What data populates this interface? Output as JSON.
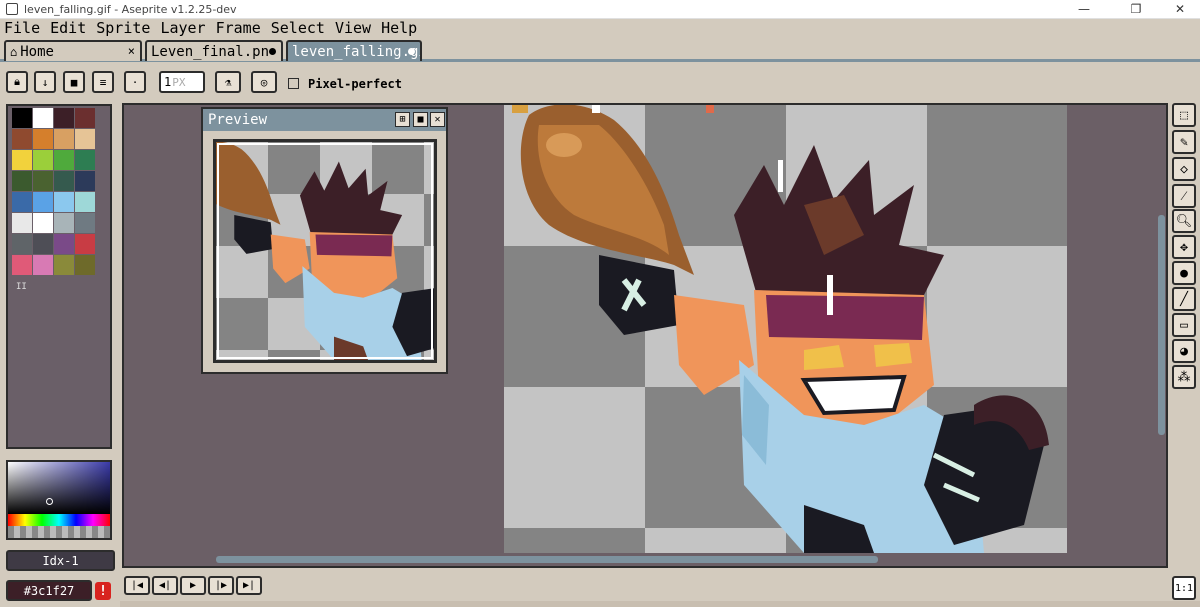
{
  "window": {
    "title": "leven_falling.gif - Aseprite v1.2.25-dev",
    "minimize": "—",
    "maximize": "❐",
    "close": "✕"
  },
  "menu": [
    "File",
    "Edit",
    "Sprite",
    "Layer",
    "Frame",
    "Select",
    "View",
    "Help"
  ],
  "tabs": [
    {
      "label": "Home",
      "icon": "home-icon",
      "trailing": "×",
      "active": false
    },
    {
      "label": "Leven_final.pn",
      "trailing": "dot",
      "active": false
    },
    {
      "label": "leven_falling.gi",
      "trailing": "dot",
      "active": true
    }
  ],
  "context_bar": {
    "brush_size_value": "1",
    "brush_size_unit": "PX",
    "pixel_perfect_label": "Pixel-perfect",
    "pixel_perfect_checked": false
  },
  "palette": {
    "colors": [
      "#000000",
      "#ffffff",
      "#3c1f27",
      "#6b2f2f",
      "#8f4a2f",
      "#d57f2c",
      "#d8a062",
      "#e6c496",
      "#f2d23c",
      "#9bcf3a",
      "#4faa3c",
      "#2d7d52",
      "#3b5a2e",
      "#4a6230",
      "#355a4e",
      "#2c3a5a",
      "#3a6aa8",
      "#5aa2e6",
      "#8bc8ee",
      "#9ed8d8",
      "#e8e8e8",
      "#ffffff",
      "#a8b4b8",
      "#6f7a82",
      "#5f6468",
      "#4e4e56",
      "#7a4a88",
      "#c83c44",
      "#e05a78",
      "#d87ab4",
      "#8a8a3a",
      "#6e6a2a"
    ],
    "badge": "II"
  },
  "color": {
    "index_label": "Idx-1",
    "hex": "#3c1f27",
    "warning_glyph": "!"
  },
  "preview": {
    "title": "Preview"
  },
  "tools": [
    "rectangular-marquee-icon",
    "pencil-icon",
    "eraser-icon",
    "eyedropper-icon",
    "zoom-icon",
    "move-icon",
    "paint-bucket-icon",
    "line-icon",
    "rectangle-icon",
    "blur-icon",
    "spray-icon"
  ],
  "animation": {
    "buttons": [
      "first-frame",
      "previous-frame",
      "play",
      "next-frame",
      "last-frame"
    ],
    "zoom_label": "1:1"
  },
  "colors": {
    "background": "#d3cbbe",
    "accent": "#7d929e",
    "editor_bg": "#6b5f66",
    "border": "#2c2c2c"
  }
}
